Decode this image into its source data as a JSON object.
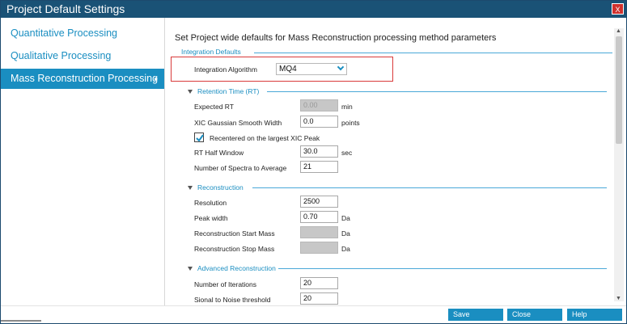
{
  "window": {
    "title": "Project Default Settings",
    "close_label": "X"
  },
  "sidebar": {
    "items": [
      {
        "label": "Quantitative Processing"
      },
      {
        "label": "Qualitative Processing"
      },
      {
        "label": "Mass Reconstruction Processing"
      }
    ],
    "active_chevron": "▸"
  },
  "content": {
    "intro": "Set Project wide defaults for Mass Reconstruction processing method parameters",
    "integration_defaults": {
      "title": "Integration Defaults",
      "algorithm_label": "Integration Algorithm",
      "algorithm_value": "MQ4"
    },
    "retention_time": {
      "title": "Retention Time (RT)",
      "expected_rt_label": "Expected RT",
      "expected_rt_value": "0.00",
      "expected_rt_unit": "min",
      "xic_label": "XIC Gaussian Smooth Width",
      "xic_value": "0.0",
      "xic_unit": "points",
      "recenter_label": "Recentered on the largest XIC Peak",
      "recenter_checked": true,
      "half_window_label": "RT Half Window",
      "half_window_value": "30.0",
      "half_window_unit": "sec",
      "spectra_label": "Number of Spectra to Average",
      "spectra_value": "21"
    },
    "reconstruction": {
      "title": "Reconstruction",
      "resolution_label": "Resolution",
      "resolution_value": "2500",
      "peak_width_label": "Peak width",
      "peak_width_value": "0.70",
      "peak_width_unit": "Da",
      "start_mass_label": "Reconstruction Start Mass",
      "start_mass_value": "",
      "start_mass_unit": "Da",
      "stop_mass_label": "Reconstruction Stop Mass",
      "stop_mass_value": "",
      "stop_mass_unit": "Da"
    },
    "advanced": {
      "title": "Advanced Reconstruction",
      "iterations_label": "Number of Iterations",
      "iterations_value": "20",
      "snr_label": "Sional to Noise threshold",
      "snr_value": "20"
    }
  },
  "footer": {
    "save": "Save",
    "close": "Close",
    "help": "Help"
  },
  "colors": {
    "title_bar": "#1a5276",
    "accent": "#1a8ec1",
    "highlight_border": "#d93a3a",
    "close_button": "#d0312d"
  }
}
